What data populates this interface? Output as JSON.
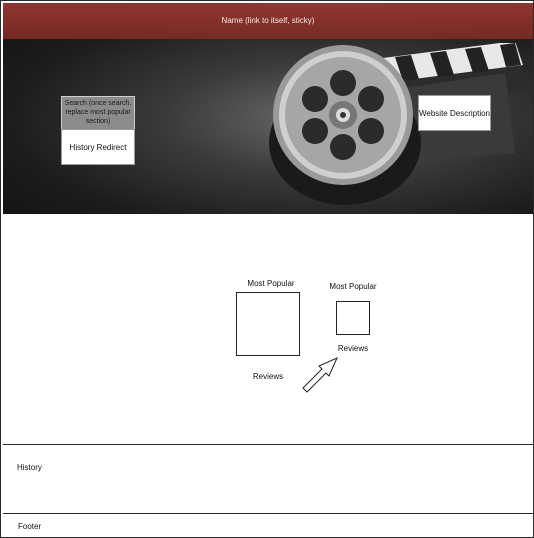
{
  "header": {
    "site_name": "Name (link to itself, sticky)"
  },
  "hero": {
    "search_text": "Search (once search, replace most popular section)",
    "history_redirect": "History Redirect",
    "website_description": "Website Description"
  },
  "main": {
    "popular_1_label": "Most Popular",
    "reviews_1_label": "Reviews",
    "popular_2_label": "Most Popular",
    "reviews_2_label": "Reviews"
  },
  "history": {
    "label": "History"
  },
  "footer": {
    "label": "Footer"
  },
  "colors": {
    "header_bar": "#8a322b",
    "hero_background": "#2a2a2a"
  }
}
